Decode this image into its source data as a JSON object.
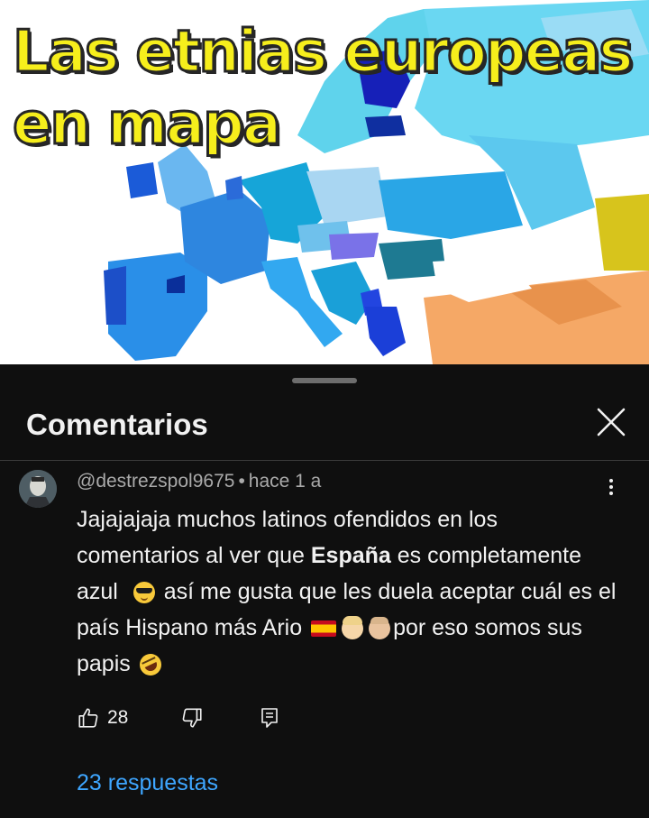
{
  "video": {
    "title_line1": "Las etnias europeas",
    "title_line2": "en mapa"
  },
  "comments_panel": {
    "title": "Comentarios",
    "close_icon": "close-icon"
  },
  "comment": {
    "author": "@destrezspol9675",
    "time": "hace 1 a",
    "text_part1": "Jajajajaja muchos latinos ofendidos en los comentarios al ver que ",
    "text_bold": "España",
    "text_part2": " es completamente azul",
    "text_part3": "así me gusta que les duela aceptar cuál es el país Hispano más Ario",
    "text_part4": "por eso somos sus papis",
    "emojis": [
      "smiling-face-with-sunglasses",
      "flag-spain",
      "baby-light-skin",
      "child-light-skin",
      "rolling-on-the-floor-laughing"
    ],
    "likes": "28",
    "replies_label": "23 respuestas"
  },
  "colors": {
    "background": "#0f0f0f",
    "text": "#f1f1f1",
    "secondary_text": "#aaaaaa",
    "link": "#3ea6ff",
    "title_yellow": "#f6ee1c"
  }
}
